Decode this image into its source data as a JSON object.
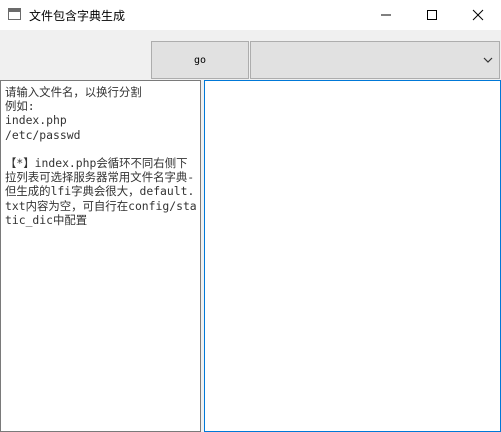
{
  "window": {
    "title": "文件包含字典生成",
    "icon": "window-app-icon",
    "controls": [
      "minimize-icon",
      "maximize-icon",
      "close-icon"
    ]
  },
  "toolbar": {
    "go_label": "go",
    "dictionary_select_value": ""
  },
  "input_area": {
    "text": "请输入文件名，以换行分割\n例如:\nindex.php\n/etc/passwd\n\n【*】index.php会循环不同右侧下拉列表可选择服务器常用文件名字典-但生成的lfi字典会很大，default.txt内容为空，可自行在config/static_dic中配置"
  },
  "output_area": {
    "text": ""
  },
  "colors": {
    "focus_border": "#0078d7",
    "button_bg": "#e1e1e1",
    "window_bg": "#f0f0f0"
  }
}
